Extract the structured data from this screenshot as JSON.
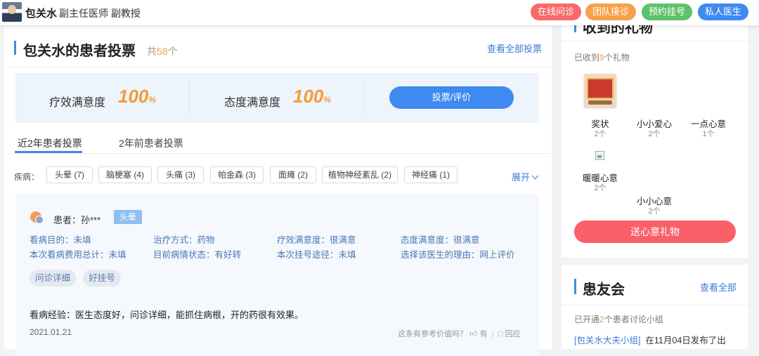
{
  "header": {
    "doctor_name": "包关水",
    "doctor_title": "副主任医师 副教授",
    "buttons": [
      {
        "label": "在线问诊",
        "color": "#f66a6a"
      },
      {
        "label": "团队接诊",
        "color": "#f5a24b"
      },
      {
        "label": "预约挂号",
        "color": "#5ec26a"
      },
      {
        "label": "私人医生",
        "color": "#3e8af0"
      }
    ]
  },
  "votes": {
    "title": "包关水的患者投票",
    "count_prefix": "共",
    "count": "58",
    "count_suffix": "个",
    "view_all": "查看全部投票",
    "efficacy_label": "疗效满意度",
    "efficacy_value": "100",
    "attitude_label": "态度满意度",
    "attitude_value": "100",
    "percent_sign": "%",
    "vote_button": "投票/评价",
    "tabs": [
      "近2年患者投票",
      "2年前患者投票"
    ],
    "disease_label": "疾病：",
    "diseases": [
      "头晕 (7)",
      "脑梗塞 (4)",
      "头痛 (3)",
      "帕金森 (3)",
      "面瘫 (2)",
      "植物神经紊乱 (2)",
      "神经痛 (1)"
    ],
    "expand": "展开"
  },
  "review": {
    "patient": "患者：孙***",
    "tag": "头晕",
    "info": [
      "看病目的：未填",
      "治疗方式：药物",
      "疗效满意度：很满意",
      "态度满意度：很满意",
      "本次看病费用总计：未填",
      "目前病情状态：有好转",
      "本次挂号途径：未填",
      "选择该医生的理由：网上评价"
    ],
    "pills": [
      "问诊详细",
      "好挂号"
    ],
    "experience": "看病经验：医生态度好，问诊详细，能抓住病根，开的药很有效果。",
    "date": "2021.01.21",
    "useful_q": "这条有参考价值吗？",
    "yes": "有",
    "reply": "回应"
  },
  "gifts": {
    "title": "收到的礼物",
    "received_prefix": "已收到",
    "received_count": "9",
    "received_suffix": "个礼物",
    "items": [
      {
        "name": "奖状",
        "count": "2个"
      },
      {
        "name": "小小爱心",
        "count": "2个"
      },
      {
        "name": "一点心意",
        "count": "1个"
      },
      {
        "name": "暖暖心意",
        "count": "2个"
      },
      {
        "name": "小小心意",
        "count": "2个"
      }
    ],
    "send_button": "送心意礼物"
  },
  "community": {
    "title": "患友会",
    "view_all": "查看全部",
    "opened_prefix": "已开通",
    "opened_count": "2",
    "opened_suffix": "个患者讨论小组",
    "group_link": "[包关水大夫小组]",
    "group_text": "在11月04日发布了出"
  }
}
